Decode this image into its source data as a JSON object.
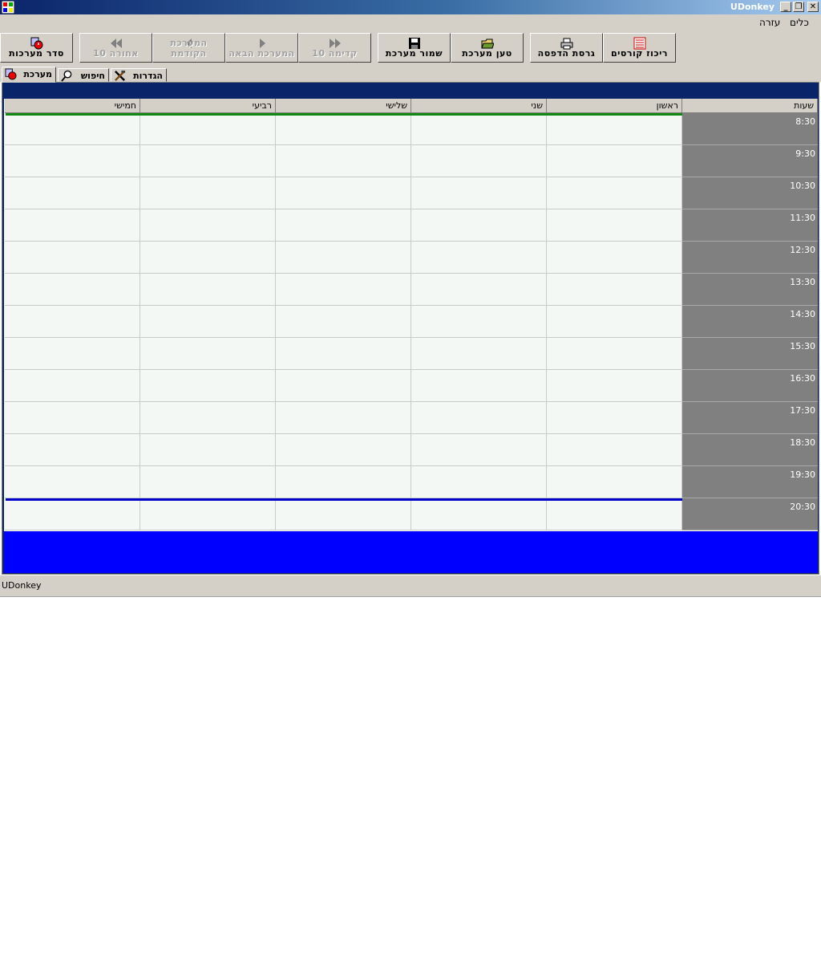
{
  "window": {
    "title": "UDonkey",
    "controls": {
      "minimize": "_",
      "restore": "❐",
      "close": "✕"
    }
  },
  "menu": [
    {
      "label": "כלים"
    },
    {
      "label": "עזרה"
    }
  ],
  "toolbar": {
    "buttons": [
      {
        "label": "ריכוז קורסים",
        "icon": "list-icon",
        "enabled": true
      },
      {
        "label": "גרסת הדפסה",
        "icon": "printer-icon",
        "enabled": true
      },
      {
        "label": "טען מערכת",
        "icon": "open-icon",
        "enabled": true
      },
      {
        "label": "שמור מערכת",
        "icon": "save-icon",
        "enabled": true
      },
      {
        "label": "קדימה 10",
        "icon": "fast-forward-icon",
        "enabled": false
      },
      {
        "label": "המערכת הבאה",
        "icon": "next-icon",
        "enabled": false
      },
      {
        "label": "המערכת הקודמת",
        "icon": "previous-icon",
        "enabled": false
      },
      {
        "label": "אחורה 10",
        "icon": "rewind-icon",
        "enabled": false
      },
      {
        "label": "סדר מערכות",
        "icon": "clock-schedule-icon",
        "enabled": true
      }
    ]
  },
  "tabs": [
    {
      "label": "מערכת",
      "icon": "clock-schedule-icon",
      "active": true
    },
    {
      "label": "חיפוש",
      "icon": "magnifier-icon",
      "active": false
    },
    {
      "label": "הגדרות",
      "icon": "tools-icon",
      "active": false
    }
  ],
  "schedule": {
    "hours_header": "שעות",
    "days": [
      "ראשון",
      "שני",
      "שלישי",
      "רביעי",
      "חמישי"
    ],
    "times": [
      "8:30",
      "9:30",
      "10:30",
      "11:30",
      "12:30",
      "13:30",
      "14:30",
      "15:30",
      "16:30",
      "17:30",
      "18:30",
      "19:30",
      "20:30"
    ]
  },
  "colors": {
    "titlebar_start": "#0a246a",
    "titlebar_end": "#a6caf0",
    "panel_header": "#0a246a",
    "time_column": "#808080",
    "grid_cell": "#f4f8f4",
    "bottom_fill": "#0000ff",
    "first_row_line": "#118811",
    "last_row_line": "#0000cc"
  },
  "status": {
    "text": "UDonkey"
  }
}
